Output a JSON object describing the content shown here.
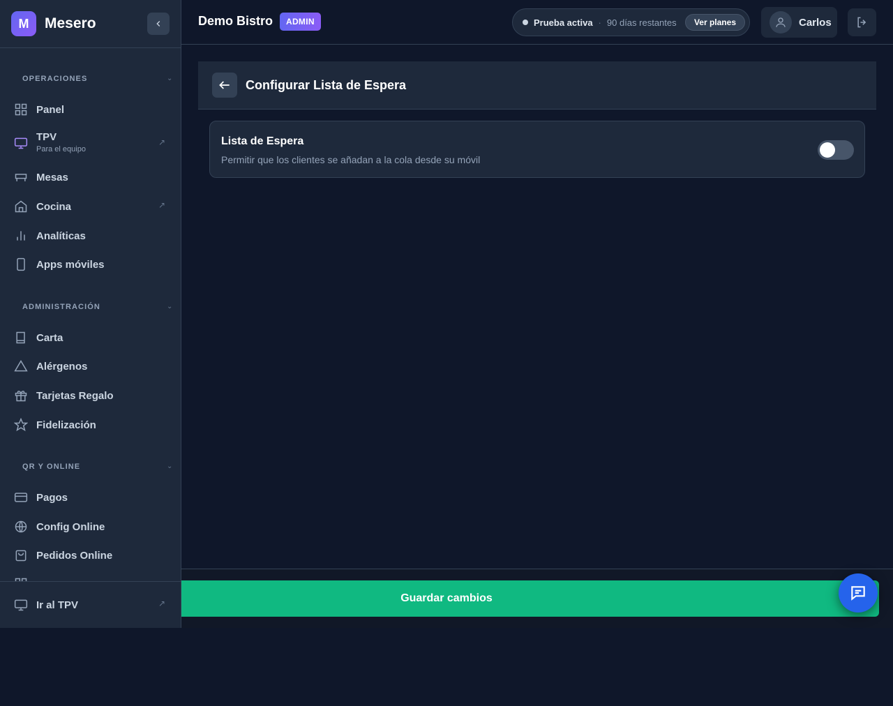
{
  "brand": {
    "logo_letter": "M",
    "name": "Mesero"
  },
  "sidebar": {
    "sections": [
      {
        "title": "OPERACIONES",
        "items": [
          {
            "label": "Panel",
            "icon": "grid-icon"
          },
          {
            "label": "TPV",
            "subtitle": "Para el equipo",
            "icon": "monitor-icon",
            "external": true
          },
          {
            "label": "Mesas",
            "icon": "table-icon"
          },
          {
            "label": "Cocina",
            "icon": "home-icon",
            "external": true
          },
          {
            "label": "Analíticas",
            "icon": "bar-chart-icon"
          },
          {
            "label": "Apps móviles",
            "icon": "phone-icon"
          }
        ]
      },
      {
        "title": "ADMINISTRACIÓN",
        "items": [
          {
            "label": "Carta",
            "icon": "book-icon"
          },
          {
            "label": "Alérgenos",
            "icon": "warning-icon"
          },
          {
            "label": "Tarjetas Regalo",
            "icon": "gift-icon"
          },
          {
            "label": "Fidelización",
            "icon": "star-icon"
          }
        ]
      },
      {
        "title": "QR Y ONLINE",
        "items": [
          {
            "label": "Pagos",
            "icon": "credit-card-icon"
          },
          {
            "label": "Config Online",
            "icon": "globe-icon"
          },
          {
            "label": "Pedidos Online",
            "icon": "shopping-bag-icon"
          }
        ]
      }
    ],
    "bottom_item": {
      "label": "Ir al TPV",
      "icon": "monitor-icon",
      "external": true
    }
  },
  "topbar": {
    "restaurant_name": "Demo Bistro",
    "role_badge": "ADMIN",
    "trial_status": "Prueba activa",
    "trial_separator": "·",
    "trial_remaining": "90 días restantes",
    "plans_button": "Ver planes",
    "user_name": "Carlos"
  },
  "page": {
    "title": "Configurar Lista de Espera",
    "setting": {
      "title": "Lista de Espera",
      "description": "Permitir que los clientes se añadan a la cola desde su móvil",
      "enabled": false
    },
    "save_button": "Guardar cambios"
  },
  "colors": {
    "accent": "#6366f1",
    "success": "#10b981",
    "chat": "#2563eb",
    "background": "#0f172a",
    "panel": "#1e293b"
  }
}
